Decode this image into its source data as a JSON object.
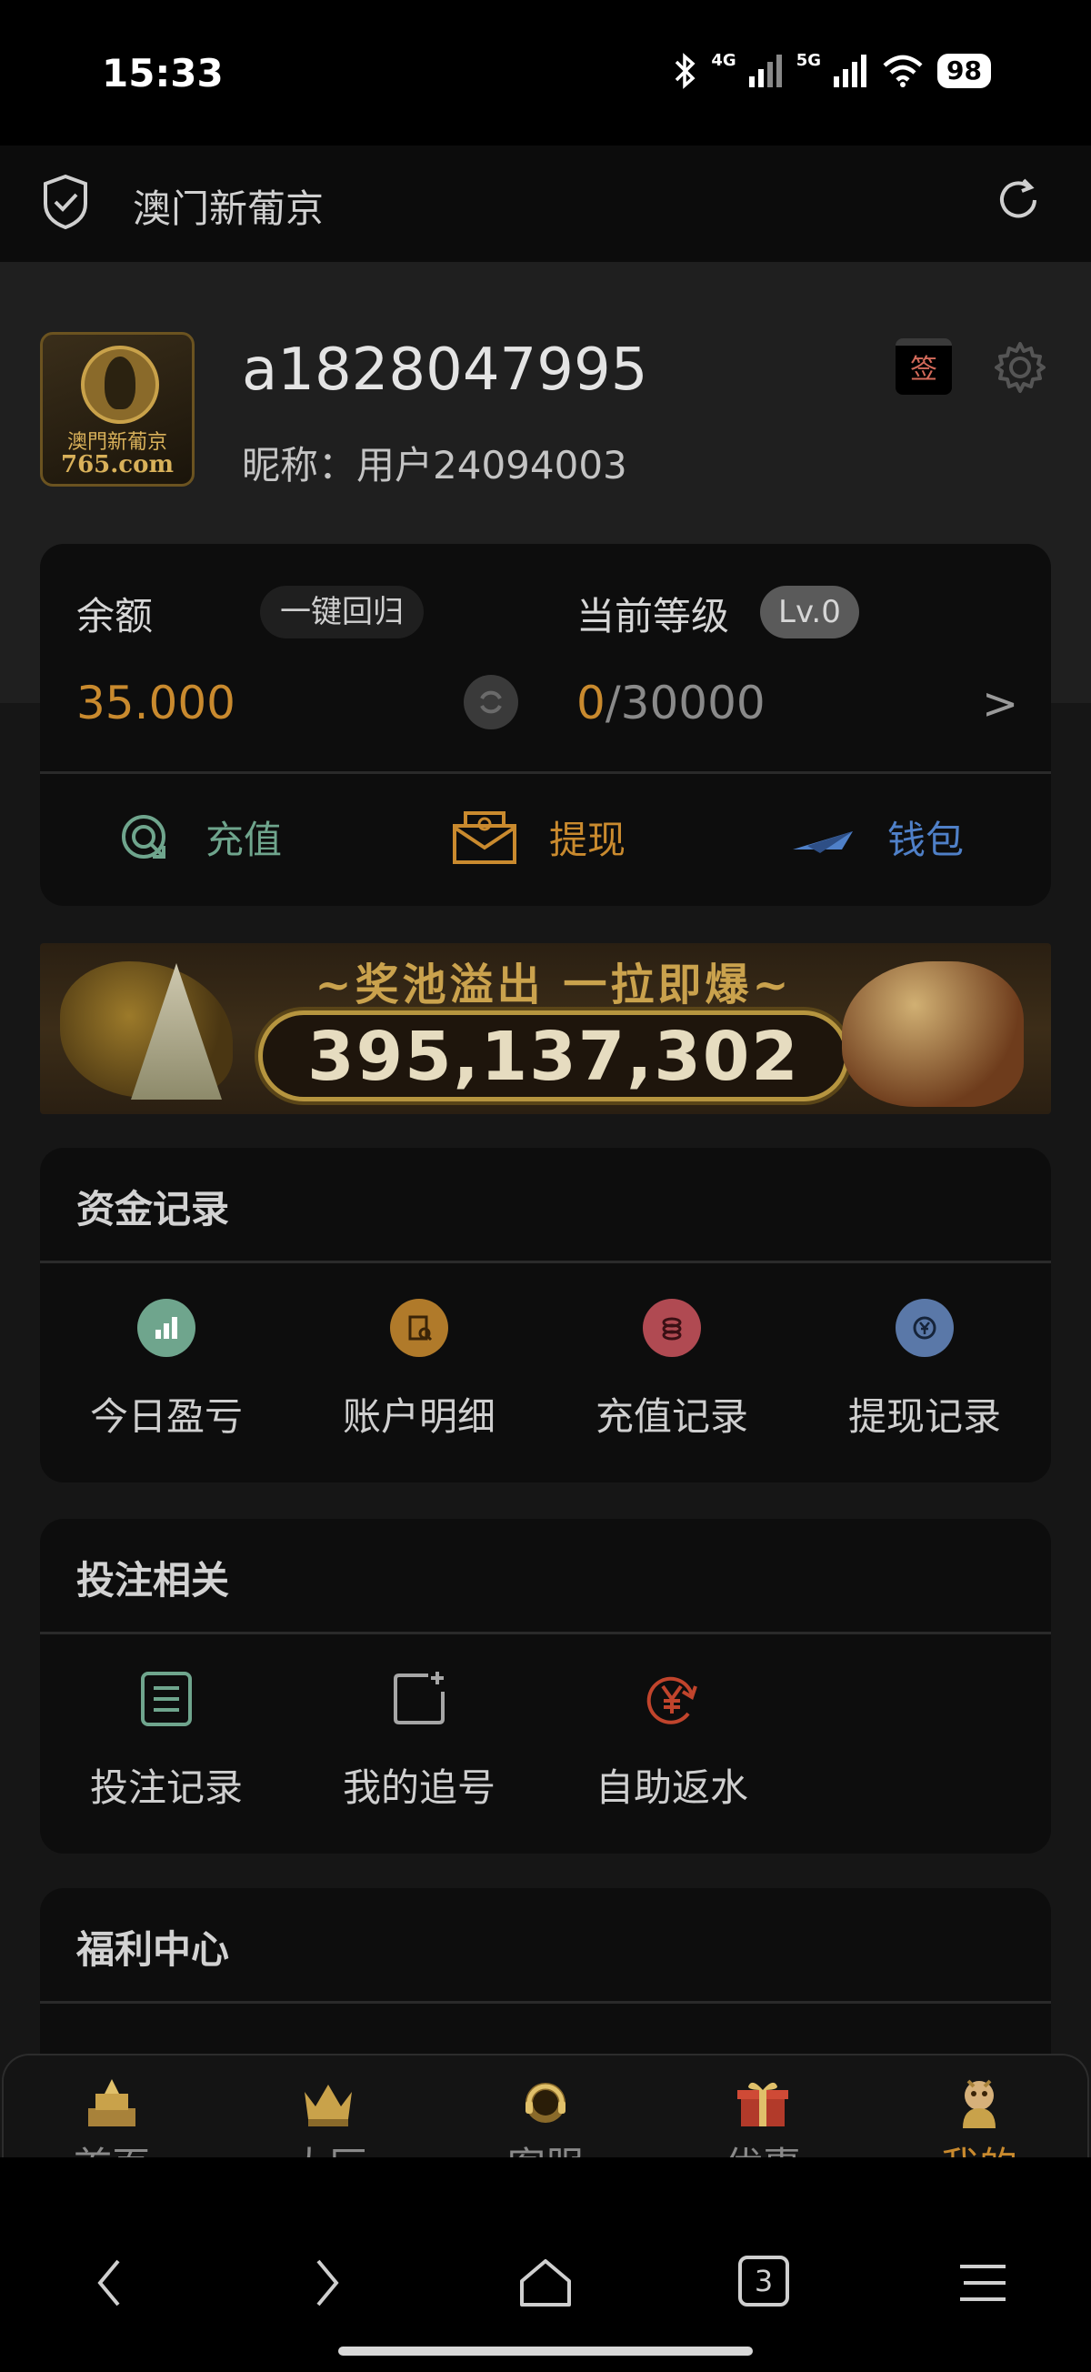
{
  "status_bar": {
    "time": "15:33",
    "net1": "4G",
    "net2": "5G",
    "battery": "98"
  },
  "browser": {
    "title": "澳门新葡京"
  },
  "profile": {
    "avatar_text_1": "澳門新葡京",
    "avatar_text_2": "765.com",
    "username": "a1828047995",
    "nickname": "昵称：用户24094003",
    "signin_label": "签"
  },
  "wallet": {
    "balance_label": "余额",
    "return_button": "一键回归",
    "balance_value": "35.000",
    "level_label": "当前等级",
    "level_badge": "Lv.0",
    "level_current": "0",
    "level_target": "/30000",
    "chevron": ">",
    "actions": [
      {
        "label": "充值",
        "color": "#6fa58d"
      },
      {
        "label": "提现",
        "color": "#c98a2e"
      },
      {
        "label": "钱包",
        "color": "#4f80c8"
      }
    ]
  },
  "banner": {
    "title": "~奖池溢出 一拉即爆~",
    "jackpot": "395,137,302"
  },
  "fund_records": {
    "title": "资金记录",
    "items": [
      {
        "label": "今日盈亏",
        "color": "#6fa58d",
        "icon": "bar-chart-icon"
      },
      {
        "label": "账户明细",
        "color": "#b07a2a",
        "icon": "document-search-icon"
      },
      {
        "label": "充值记录",
        "color": "#b04a52",
        "icon": "coins-icon"
      },
      {
        "label": "提现记录",
        "color": "#5a78a8",
        "icon": "yen-exchange-icon"
      }
    ]
  },
  "bet_related": {
    "title": "投注相关",
    "items": [
      {
        "label": "投注记录",
        "color": "#6fa58d",
        "icon": "list-icon"
      },
      {
        "label": "我的追号",
        "color": "#a6a6a6",
        "icon": "add-note-icon"
      },
      {
        "label": "自助返水",
        "color": "#c0442c",
        "icon": "yen-cycle-icon"
      }
    ]
  },
  "welfare": {
    "title": "福利中心"
  },
  "tabs": [
    {
      "label": "首页",
      "icon": "home-palace-icon"
    },
    {
      "label": "大厅",
      "icon": "crown-icon"
    },
    {
      "label": "客服",
      "icon": "headset-icon"
    },
    {
      "label": "优惠",
      "icon": "gift-icon"
    },
    {
      "label": "我的",
      "icon": "mascot-icon",
      "active": true
    }
  ],
  "nav": {
    "tabs_count": "3"
  }
}
